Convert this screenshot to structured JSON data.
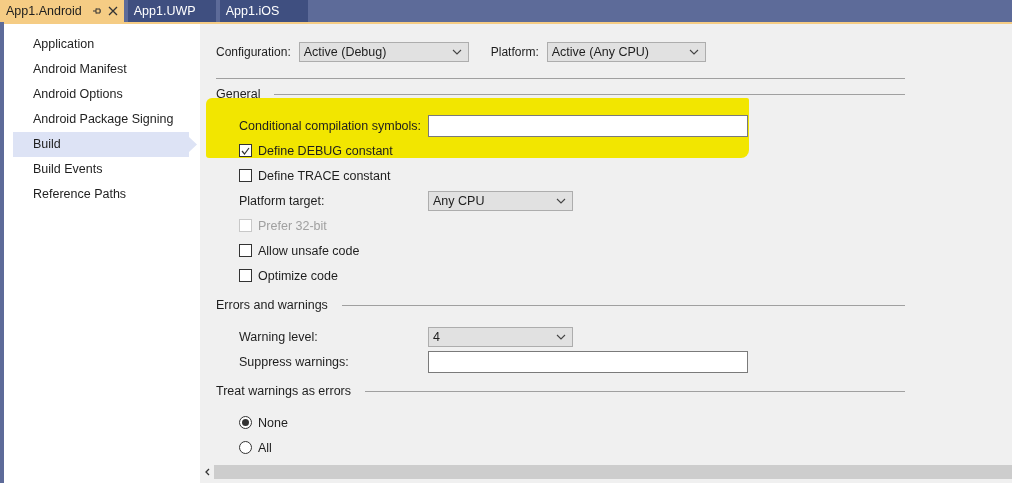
{
  "tabs": [
    {
      "label": "App1.Android",
      "selected": true
    },
    {
      "label": "App1.UWP",
      "selected": false
    },
    {
      "label": "App1.iOS",
      "selected": false
    }
  ],
  "sidebar": {
    "items": [
      {
        "label": "Application",
        "selected": false
      },
      {
        "label": "Android Manifest",
        "selected": false
      },
      {
        "label": "Android Options",
        "selected": false
      },
      {
        "label": "Android Package Signing",
        "selected": false
      },
      {
        "label": "Build",
        "selected": true
      },
      {
        "label": "Build Events",
        "selected": false
      },
      {
        "label": "Reference Paths",
        "selected": false
      }
    ]
  },
  "configuration": {
    "label": "Configuration:",
    "value": "Active (Debug)"
  },
  "platform": {
    "label": "Platform:",
    "value": "Active (Any CPU)"
  },
  "sections": [
    {
      "title": "General",
      "rows": [
        {
          "kind": "text",
          "label": "Conditional compilation symbols:"
        },
        {
          "kind": "checkbox",
          "label": "Define DEBUG constant",
          "checked": true,
          "disabled": false
        },
        {
          "kind": "checkbox",
          "label": "Define TRACE constant",
          "checked": false,
          "disabled": false
        },
        {
          "kind": "dropdown",
          "label": "Platform target:",
          "value": "Any CPU"
        },
        {
          "kind": "checkbox",
          "label": "Prefer 32-bit",
          "checked": false,
          "disabled": true
        },
        {
          "kind": "checkbox",
          "label": "Allow unsafe code",
          "checked": false,
          "disabled": false
        },
        {
          "kind": "checkbox",
          "label": "Optimize code",
          "checked": false,
          "disabled": false
        }
      ]
    },
    {
      "title": "Errors and warnings",
      "rows": [
        {
          "kind": "dropdown",
          "label": "Warning level:",
          "value": "4"
        },
        {
          "kind": "text",
          "label": "Suppress warnings:"
        }
      ]
    },
    {
      "title": "Treat warnings as errors",
      "rows": [
        {
          "kind": "radio",
          "label": "None",
          "selected": true
        },
        {
          "kind": "radio",
          "label": "All",
          "selected": false
        }
      ]
    }
  ]
}
